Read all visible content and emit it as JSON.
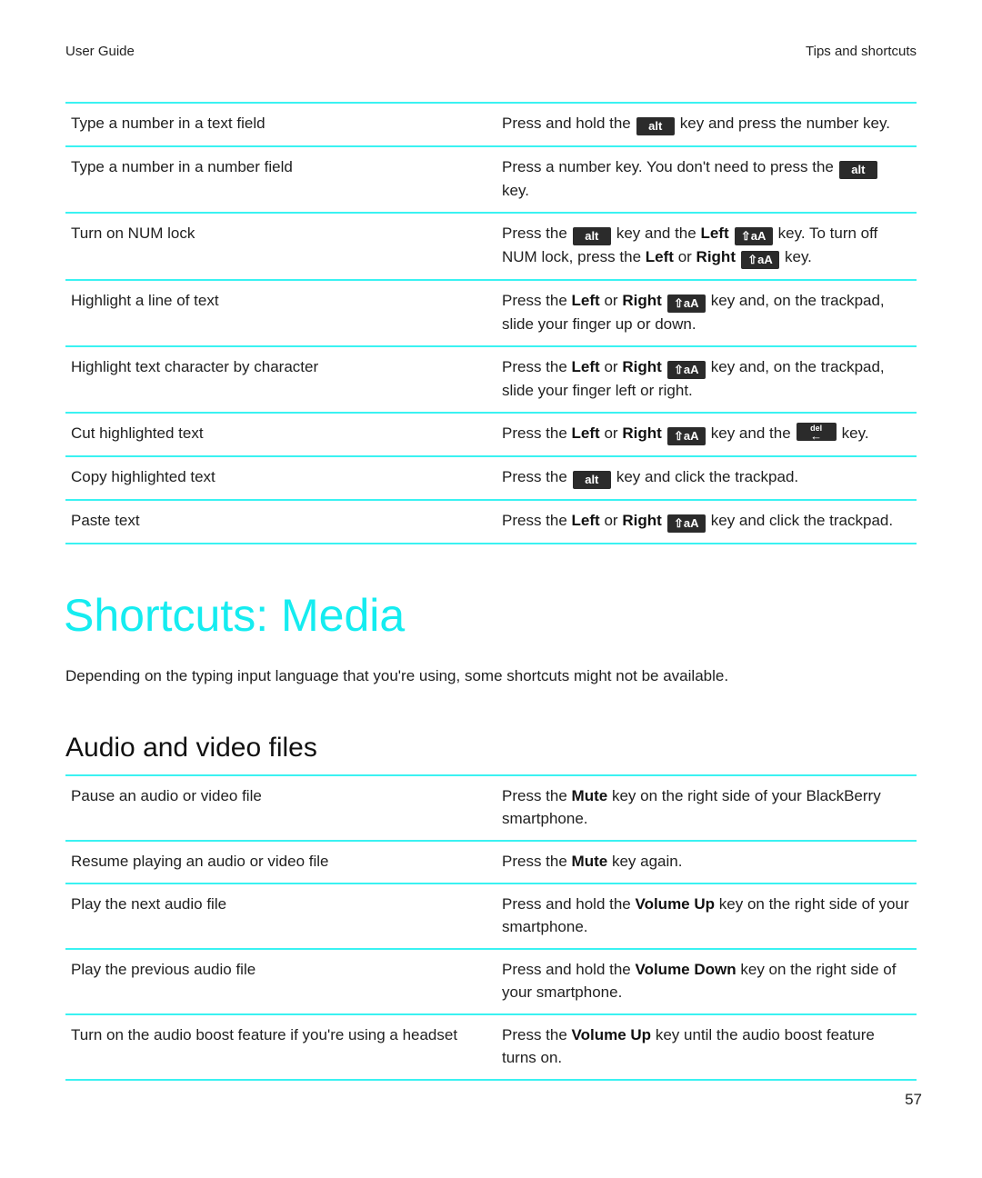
{
  "header": {
    "left": "User Guide",
    "right": "Tips and shortcuts"
  },
  "colors": {
    "accent": "#15ecf0",
    "rule": "#3af2f2",
    "key_bg": "#2b2b2b"
  },
  "keys": {
    "alt": "alt",
    "shift": "⇧aA",
    "del": "del",
    "del_arrow": "←"
  },
  "text_table": [
    {
      "action": "Type a number in a text field",
      "parts": [
        "Press and hold the",
        "key and press the number key."
      ]
    },
    {
      "action": "Type a number in a number field",
      "parts": [
        "Press a number key. You don't need to press the",
        "key."
      ]
    },
    {
      "action": "Turn on NUM lock",
      "parts": [
        "Press the",
        "key and the",
        "Left",
        "key. To turn off NUM lock, press the",
        "Left",
        "or",
        "Right",
        "key."
      ]
    },
    {
      "action": "Highlight a line of text",
      "parts": [
        "Press the",
        "Left",
        "or",
        "Right",
        "key and, on the trackpad, slide your finger up or down."
      ]
    },
    {
      "action": "Highlight text character by character",
      "parts": [
        "Press the",
        "Left",
        "or",
        "Right",
        "key and, on the trackpad, slide your finger left or right."
      ]
    },
    {
      "action": "Cut highlighted text",
      "parts": [
        "Press the",
        "Left",
        "or",
        "Right",
        "key and the",
        "key."
      ]
    },
    {
      "action": "Copy highlighted text",
      "parts": [
        "Press the",
        "key and click the trackpad."
      ]
    },
    {
      "action": "Paste text",
      "parts": [
        "Press the",
        "Left",
        "or",
        "Right",
        "key and click the trackpad."
      ]
    }
  ],
  "section": {
    "title": "Shortcuts: Media",
    "intro": "Depending on the typing input language that you're using, some shortcuts might not be available.",
    "subtitle": "Audio and video files"
  },
  "media_table": [
    {
      "action": "Pause an audio or video file",
      "parts": [
        "Press the",
        "Mute",
        "key on the right side of your BlackBerry smartphone."
      ]
    },
    {
      "action": "Resume playing an audio or video file",
      "parts": [
        "Press the",
        "Mute",
        "key again."
      ]
    },
    {
      "action": "Play the next audio file",
      "parts": [
        "Press and hold the",
        "Volume Up",
        "key on the right side of your smartphone."
      ]
    },
    {
      "action": "Play the previous audio file",
      "parts": [
        "Press and hold the",
        "Volume Down",
        "key on the right side of your smartphone."
      ]
    },
    {
      "action": "Turn on the audio boost feature if you're using a headset",
      "parts": [
        "Press the",
        "Volume Up",
        "key until the audio boost feature turns on."
      ]
    }
  ],
  "page_number": "57"
}
